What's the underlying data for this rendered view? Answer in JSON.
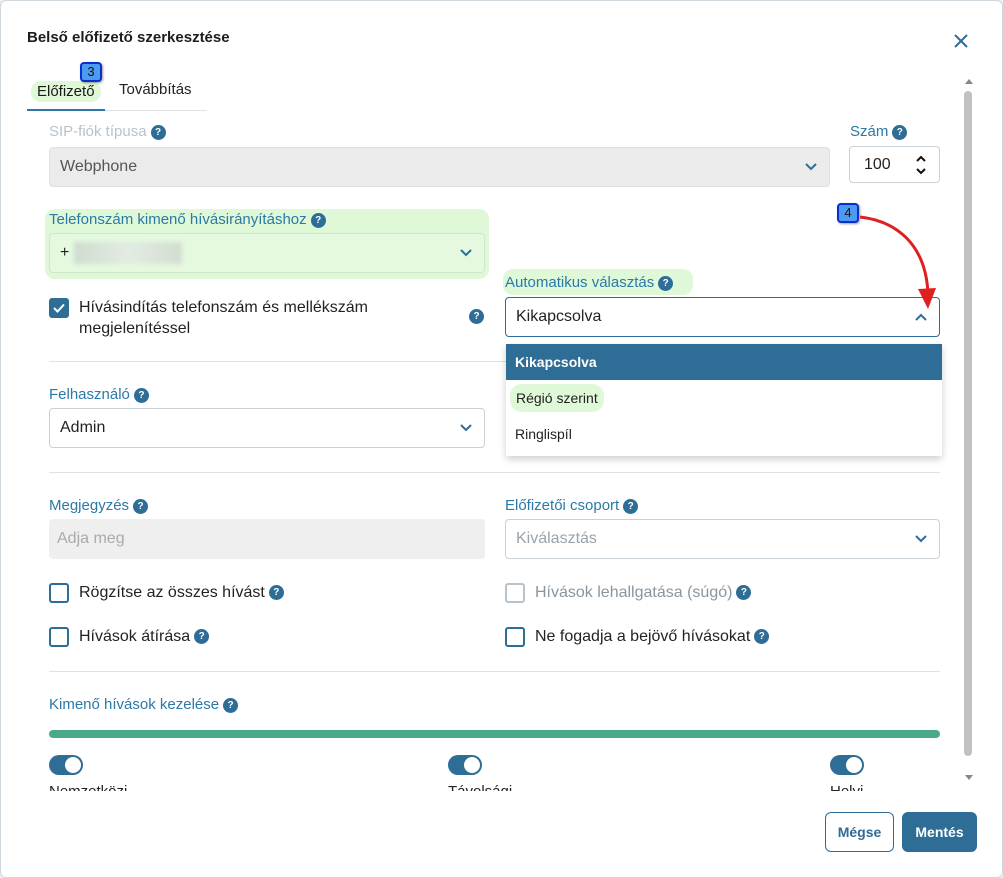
{
  "dialog": {
    "title": "Belső előfizető szerkesztése"
  },
  "tabs": [
    {
      "label": "Előfizető"
    },
    {
      "label": "Továbbítás"
    }
  ],
  "badges": {
    "tab": "3",
    "arrow": "4"
  },
  "sip": {
    "label": "SIP-fiók típusa",
    "value": "Webphone"
  },
  "szam": {
    "label": "Szám",
    "value": "100"
  },
  "phone": {
    "label": "Telefonszám kimenő hívásirányításhoz",
    "value": "+"
  },
  "call_display": {
    "label": "Hívásindítás telefonszám és mellékszám megjelenítéssel",
    "checked": true
  },
  "auto": {
    "label": "Automatikus választás",
    "value": "Kikapcsolva",
    "options": [
      "Kikapcsolva",
      "Régió szerint",
      "Ringlispíl"
    ]
  },
  "felhasznalo": {
    "label": "Felhasználó",
    "value": "Admin"
  },
  "megjegyzes": {
    "label": "Megjegyzés",
    "placeholder": "Adja meg"
  },
  "csoport": {
    "label": "Előfizetői csoport",
    "placeholder": "Kiválasztás"
  },
  "checks": {
    "record": "Rögzítse az összes hívást",
    "transcribe": "Hívások átírása",
    "listen": "Hívások lehallgatása (súgó)",
    "reject": "Ne fogadja a bejövő hívásokat"
  },
  "outgoing": {
    "label": "Kimenő hívások kezelése"
  },
  "toggle_labels": [
    "Nemzetközi",
    "Távolsági",
    "Helyi"
  ],
  "buttons": {
    "cancel": "Mégse",
    "save": "Mentés"
  },
  "help_glyph": "?",
  "colors": {
    "accent": "#2e6d96",
    "label": "#2b79a6",
    "highlight": "#dff8d8",
    "progress": "#4aa98b",
    "arrow": "#e02020"
  }
}
